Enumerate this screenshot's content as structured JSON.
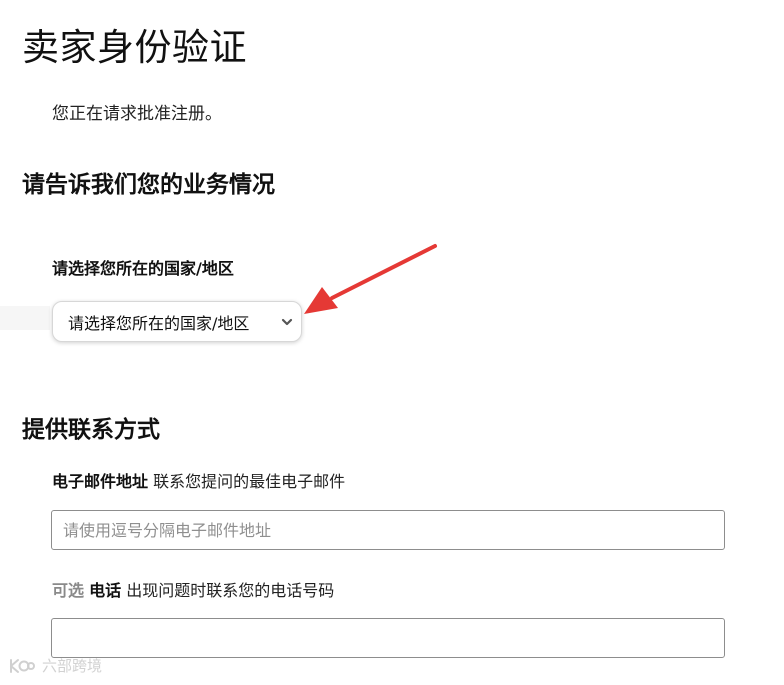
{
  "page": {
    "title": "卖家身份验证",
    "subtitle": "您正在请求批准注册。"
  },
  "business_section": {
    "title": "请告诉我们您的业务情况",
    "country_label": "请选择您所在的国家/地区",
    "country_select_value": "请选择您所在的国家/地区",
    "dropdown_icon": "chevron-down-icon"
  },
  "contact_section": {
    "title": "提供联系方式",
    "email": {
      "label": "电子邮件地址",
      "description": "联系您提问的最佳电子邮件",
      "value": "",
      "placeholder": "请使用逗号分隔电子邮件地址"
    },
    "phone": {
      "optional_tag": "可选",
      "label": "电话",
      "description": "出现问题时联系您的电话号码",
      "value": "",
      "placeholder": ""
    }
  },
  "annotation": {
    "color": "#e53935",
    "icon": "red-arrow-icon"
  },
  "watermark": {
    "text": "六部跨境",
    "icon": "watermark-logo-icon"
  }
}
